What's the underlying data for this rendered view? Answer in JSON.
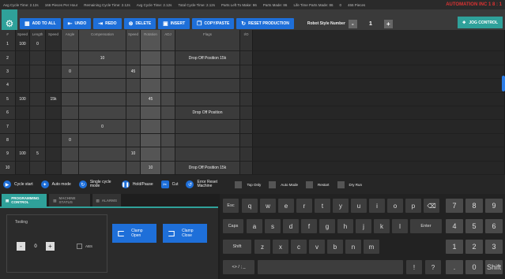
{
  "status_bar": {
    "items": [
      "Avg Cycle Time: 2.12s",
      "166 Pieces Per Hour",
      "Remaining Cycle Time: 2.12s",
      "Avg Cycle Time: 2.12s",
      "Total Cycle Time: 2.12s",
      "Parts Left To Make: 86",
      "Parts Made: 86",
      "Life Time Parts Made: 86",
      "0",
      "466 Pieces"
    ],
    "logo": "AUTOMATION INC",
    "time": "1 8 : 1"
  },
  "toolbar": {
    "add_to_all": "ADD TO ALL",
    "undo": "UNDO",
    "redo": "REDO",
    "delete": "DELETE",
    "insert": "INSERT",
    "copy_paste": "COPY/PASTE",
    "reset_production": "RESET PRODUCTION",
    "robot_style_label": "Robot Style Number",
    "robot_style_value": "1",
    "jog_control": "JOG CONTROL"
  },
  "grid": {
    "headers": [
      "#",
      "Speed",
      "Length",
      "Speed",
      "Angle",
      "Compensation",
      "Speed",
      "Rotation",
      "ADJ",
      "Flags",
      "I/O",
      ""
    ],
    "rows": [
      [
        "1",
        "100",
        "0",
        "",
        "",
        "",
        "",
        "",
        "",
        "",
        "",
        ""
      ],
      [
        "2",
        "",
        "",
        "",
        "",
        "10",
        "",
        "",
        "",
        "Drop Off Position 15k",
        "",
        ""
      ],
      [
        "3",
        "",
        "",
        "",
        "0",
        "",
        "45",
        "",
        "",
        "",
        "",
        ""
      ],
      [
        "4",
        "",
        "",
        "",
        "",
        "",
        "",
        "",
        "",
        "",
        "",
        ""
      ],
      [
        "5",
        "100",
        "",
        "15k",
        "",
        "",
        "",
        "45",
        "",
        "",
        "",
        ""
      ],
      [
        "6",
        "",
        "",
        "",
        "",
        "",
        "",
        "",
        "",
        "Drop Off Position",
        "",
        ""
      ],
      [
        "7",
        "",
        "",
        "",
        "",
        "0",
        "",
        "",
        "",
        "",
        "",
        ""
      ],
      [
        "8",
        "",
        "",
        "",
        "0",
        "",
        "",
        "",
        "",
        "",
        "",
        ""
      ],
      [
        "9",
        "100",
        "5",
        "",
        "",
        "",
        "10",
        "",
        "",
        "",
        "",
        ""
      ],
      [
        "10",
        "",
        "",
        "",
        "",
        "",
        "",
        "10",
        "",
        "Drop Off Position 15k",
        "",
        ""
      ]
    ]
  },
  "controls": {
    "cycle_start": "Cycle start",
    "auto_mode": "Auto mode",
    "single_cycle": "Single cycle mode",
    "hold_pause": "Hold/Pause",
    "cut": "Cut",
    "error_reset": "Error Reset Machine",
    "top_only": "Top Only",
    "auto_mode_chk": "Auto Mode",
    "restart": "Restart",
    "dry_run": "Dry Run"
  },
  "tabs": {
    "programming": "PROGRAMMING CONTROL",
    "machine_status": "MACHINE STATUS",
    "alarms": "ALARMS"
  },
  "tooling": {
    "label": "Tooling",
    "value": "0",
    "minus": "-",
    "plus": "+",
    "abs": "ABS",
    "clamp_open": "Clamp Open",
    "clamp_close": "Clamp Close"
  },
  "keyboard": {
    "row1": [
      "Esc",
      "q",
      "w",
      "e",
      "r",
      "t",
      "y",
      "u",
      "i",
      "o",
      "p",
      "⌫"
    ],
    "row2": [
      "Caps",
      "a",
      "s",
      "d",
      "f",
      "g",
      "h",
      "j",
      "k",
      "l",
      "Enter"
    ],
    "row3": [
      "Shift",
      "z",
      "x",
      "c",
      "v",
      "b",
      "n",
      "m"
    ],
    "row4": [
      "<> / ; _",
      "!",
      "?"
    ],
    "numpad": [
      "7",
      "8",
      "9",
      "4",
      "5",
      "6",
      "1",
      "2",
      "3",
      ".",
      "0",
      "Shift"
    ]
  },
  "colors": {
    "accent": "#1e6fd9",
    "teal": "#2fa19a",
    "logo": "#dd3333"
  }
}
